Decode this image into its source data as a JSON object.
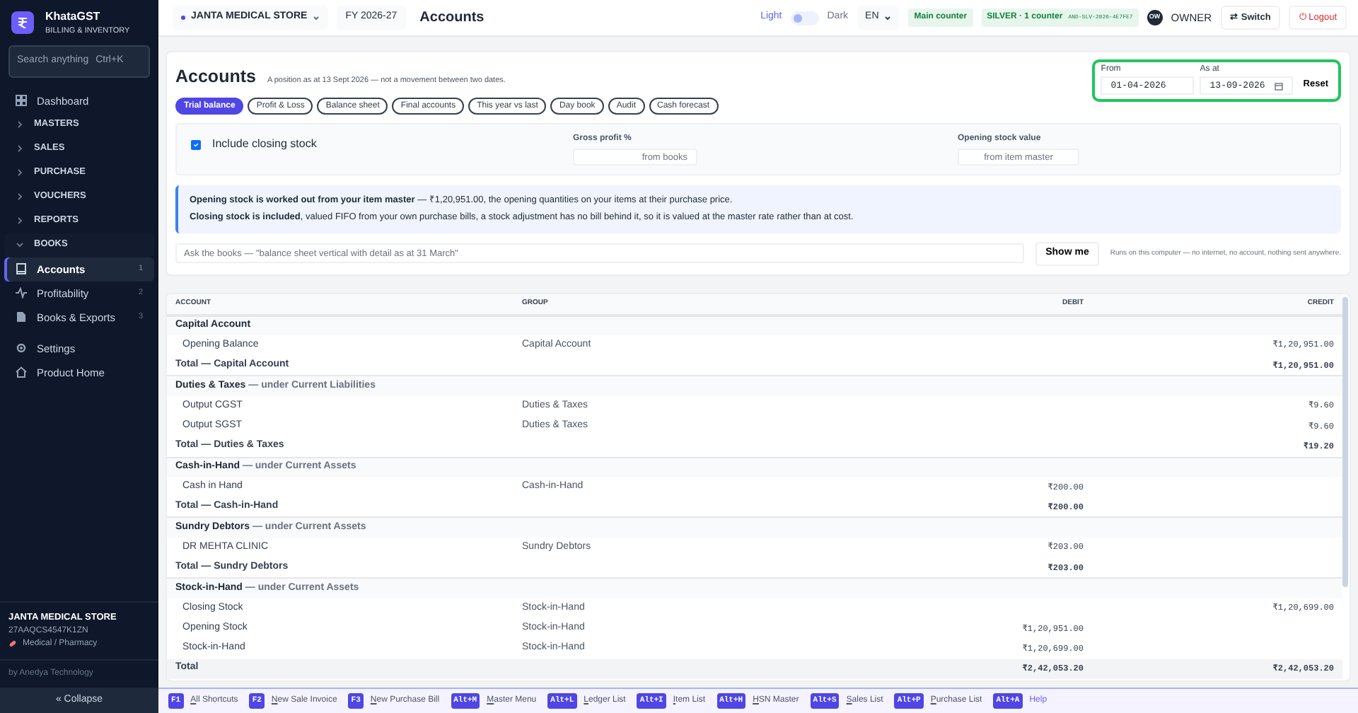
{
  "sidebar": {
    "brand": "KhataGST",
    "tagline": "BILLING & INVENTORY",
    "search": {
      "placeholder": "Search anything",
      "shortcut": "Ctrl+K"
    },
    "items": [
      {
        "kind": "link",
        "label": "Dashboard",
        "selected": false
      },
      {
        "kind": "section",
        "label": "MASTERS",
        "expanded": false
      },
      {
        "kind": "section",
        "label": "SALES",
        "expanded": false
      },
      {
        "kind": "section",
        "label": "PURCHASE",
        "expanded": false
      },
      {
        "kind": "section",
        "label": "VOUCHERS",
        "expanded": false
      },
      {
        "kind": "section",
        "label": "REPORTS",
        "expanded": false
      },
      {
        "kind": "section",
        "label": "BOOKS",
        "expanded": true,
        "children": [
          {
            "kind": "link",
            "label": "Accounts",
            "count": "1",
            "selected": true
          },
          {
            "kind": "link",
            "label": "Profitability",
            "count": "2",
            "selected": false
          },
          {
            "kind": "link",
            "label": "Books & Exports",
            "count": "3",
            "selected": false
          }
        ]
      },
      {
        "kind": "link",
        "label": "Settings",
        "selected": false
      },
      {
        "kind": "link",
        "label": "Product Home",
        "selected": false
      }
    ],
    "store": {
      "name": "JANTA MEDICAL STORE",
      "gstin": "27AAQCS4547K1ZN",
      "type": "Medical / Pharmacy"
    },
    "credit": "by Anedya Technology",
    "collapse": "« Collapse"
  },
  "topbar": {
    "company": "JANTA MEDICAL STORE",
    "fy": "FY 2026-27",
    "title": "Accounts",
    "light": "Light",
    "dark": "Dark",
    "dark_mode": false,
    "language": "EN",
    "counter": "Main counter",
    "plan": "SILVER · 1 counter",
    "licence": "AND-SLV-2026-4E7FE7",
    "avatar": "OW",
    "role": "OWNER",
    "switch": "⇄ Switch",
    "logout": "⏻ Logout"
  },
  "header": {
    "title": "Accounts",
    "subtitle": "A position as at 13 Sept 2026 — not a movement between two dates.",
    "from_label": "From",
    "from": "01-04-2026",
    "asat_label": "As at",
    "asat": "13-09-2026",
    "reset": "Reset"
  },
  "tabs": [
    {
      "label": "Trial balance",
      "selected": true
    },
    {
      "label": "Profit & Loss",
      "selected": false
    },
    {
      "label": "Balance sheet",
      "selected": false
    },
    {
      "label": "Final accounts",
      "selected": false
    },
    {
      "label": "This year vs last",
      "selected": false
    },
    {
      "label": "Day book",
      "selected": false
    },
    {
      "label": "Audit",
      "selected": false
    },
    {
      "label": "Cash forecast",
      "selected": false
    }
  ],
  "options": {
    "closing_stock": {
      "label": "Include closing stock",
      "checked": true
    },
    "gross_profit": {
      "label": "Gross profit %",
      "placeholder": "from books"
    },
    "opening_stock": {
      "label": "Opening stock value",
      "placeholder": "from item master"
    }
  },
  "notice": [
    "**Opening stock is worked out from your item master** — ₹1,20,951.00, the opening quantities on your items at their purchase price.",
    "**Closing stock is included**, valued FIFO from your own purchase bills, a stock adjustment has no bill behind it, so it is valued at the master rate rather than at cost."
  ],
  "ask": {
    "placeholder": "Ask the books — \"balance sheet vertical with detail as at 31 March\"",
    "button": "Show me",
    "note": "Runs on this computer — no internet, no account, nothing sent anywhere."
  },
  "table": {
    "columns": [
      "ACCOUNT",
      "GROUP",
      "DEBIT",
      "CREDIT"
    ],
    "rows": [
      {
        "kind": "group",
        "name": "Capital Account"
      },
      {
        "kind": "line",
        "name": "Opening Balance",
        "group": "Capital Account",
        "credit": "₹1,20,951.00"
      },
      {
        "kind": "total",
        "name": "Total — Capital Account",
        "credit": "₹1,20,951.00"
      },
      {
        "kind": "group",
        "name": "Duties & Taxes",
        "under": "— under Current Liabilities"
      },
      {
        "kind": "line",
        "name": "Output CGST",
        "group": "Duties & Taxes",
        "credit": "₹9.60"
      },
      {
        "kind": "line",
        "name": "Output SGST",
        "group": "Duties & Taxes",
        "credit": "₹9.60"
      },
      {
        "kind": "total",
        "name": "Total — Duties & Taxes",
        "credit": "₹19.20"
      },
      {
        "kind": "group",
        "name": "Cash-in-Hand",
        "under": "— under Current Assets"
      },
      {
        "kind": "line",
        "name": "Cash in Hand",
        "group": "Cash-in-Hand",
        "debit": "₹200.00"
      },
      {
        "kind": "total",
        "name": "Total — Cash-in-Hand",
        "debit": "₹200.00"
      },
      {
        "kind": "group",
        "name": "Sundry Debtors",
        "under": "— under Current Assets"
      },
      {
        "kind": "line",
        "name": "DR MEHTA CLINIC",
        "group": "Sundry Debtors",
        "debit": "₹203.00"
      },
      {
        "kind": "total",
        "name": "Total — Sundry Debtors",
        "debit": "₹203.00"
      },
      {
        "kind": "group",
        "name": "Stock-in-Hand",
        "under": "— under Current Assets"
      },
      {
        "kind": "line",
        "name": "Closing Stock",
        "group": "Stock-in-Hand",
        "credit": "₹1,20,699.00"
      },
      {
        "kind": "line",
        "name": "Opening Stock",
        "group": "Stock-in-Hand",
        "debit": "₹1,20,951.00"
      },
      {
        "kind": "line",
        "name": "Stock-in-Hand",
        "group": "Stock-in-Hand",
        "debit": "₹1,20,699.00"
      },
      {
        "kind": "grand",
        "name": "Total",
        "debit": "₹2,42,053.20",
        "credit": "₹2,42,053.20"
      }
    ]
  },
  "shortcuts": [
    {
      "key": "F1",
      "label": "All Shortcuts"
    },
    {
      "key": "F2",
      "label": "New Sale Invoice"
    },
    {
      "key": "F3",
      "label": "New Purchase Bill"
    },
    {
      "key": "Alt+M",
      "label": "Master Menu"
    },
    {
      "key": "Alt+L",
      "label": "Ledger List"
    },
    {
      "key": "Alt+I",
      "label": "Item List"
    },
    {
      "key": "Alt+H",
      "label": "HSN Master"
    },
    {
      "key": "Alt+S",
      "label": "Sales List"
    },
    {
      "key": "Alt+P",
      "label": "Purchase List"
    },
    {
      "key": "Alt+A",
      "label": "Help",
      "accent": true
    }
  ]
}
